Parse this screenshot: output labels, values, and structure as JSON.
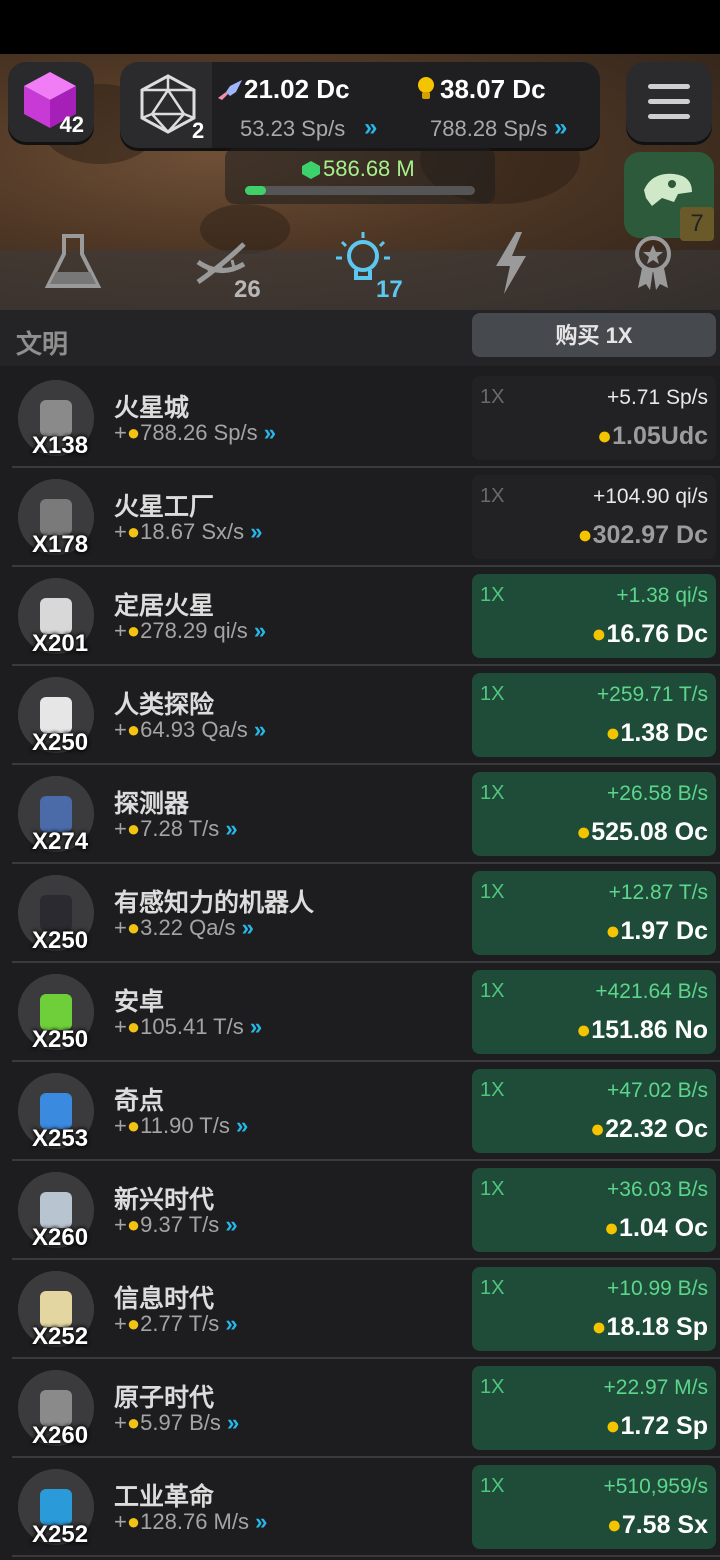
{
  "top": {
    "cube_level": "42",
    "d20_count": "2",
    "resource1": {
      "value": "21.02 Dc",
      "rate": "53.23 Sp/s"
    },
    "resource2": {
      "value": "38.07 Dc",
      "rate": "788.28 Sp/s"
    },
    "gems": {
      "value": "586.68 M",
      "progress": 0.09
    },
    "dino_badge": "7"
  },
  "tabs": [
    {
      "icon": "flask-icon",
      "badge": ""
    },
    {
      "icon": "dna-icon",
      "badge": "26"
    },
    {
      "icon": "lightbulb-icon",
      "badge": "17",
      "active": true
    },
    {
      "icon": "lightning-icon",
      "badge": ""
    },
    {
      "icon": "award-icon",
      "badge": ""
    }
  ],
  "section": {
    "title": "文明",
    "buy_label": "购买 1X"
  },
  "rows": [
    {
      "name": "火星城",
      "count": "X138",
      "rate": "788.26 Sp/s",
      "mult": "1X",
      "gain": "+5.71 Sp/s",
      "cost": "1.05Udc",
      "affordable": false,
      "color": "#8a8a8a"
    },
    {
      "name": "火星工厂",
      "count": "X178",
      "rate": "18.67 Sx/s",
      "mult": "1X",
      "gain": "+104.90 qi/s",
      "cost": "302.97 Dc",
      "affordable": false,
      "color": "#7a7a7a"
    },
    {
      "name": "定居火星",
      "count": "X201",
      "rate": "278.29 qi/s",
      "mult": "1X",
      "gain": "+1.38 qi/s",
      "cost": "16.76 Dc",
      "affordable": true,
      "color": "#d8d8d8"
    },
    {
      "name": "人类探险",
      "count": "X250",
      "rate": "64.93 Qa/s",
      "mult": "1X",
      "gain": "+259.71 T/s",
      "cost": "1.38 Dc",
      "affordable": true,
      "color": "#e6e6e6"
    },
    {
      "name": "探测器",
      "count": "X274",
      "rate": "7.28 T/s",
      "mult": "1X",
      "gain": "+26.58 B/s",
      "cost": "525.08 Oc",
      "affordable": true,
      "color": "#4a6aa8"
    },
    {
      "name": "有感知力的机器人",
      "count": "X250",
      "rate": "3.22 Qa/s",
      "mult": "1X",
      "gain": "+12.87 T/s",
      "cost": "1.97 Dc",
      "affordable": true,
      "color": "#2a2a30"
    },
    {
      "name": "安卓",
      "count": "X250",
      "rate": "105.41 T/s",
      "mult": "1X",
      "gain": "+421.64 B/s",
      "cost": "151.86 No",
      "affordable": true,
      "color": "#6fcf3a"
    },
    {
      "name": "奇点",
      "count": "X253",
      "rate": "11.90 T/s",
      "mult": "1X",
      "gain": "+47.02 B/s",
      "cost": "22.32 Oc",
      "affordable": true,
      "color": "#3a8ae0"
    },
    {
      "name": "新兴时代",
      "count": "X260",
      "rate": "9.37 T/s",
      "mult": "1X",
      "gain": "+36.03 B/s",
      "cost": "1.04 Oc",
      "affordable": true,
      "color": "#b8c4d0"
    },
    {
      "name": "信息时代",
      "count": "X252",
      "rate": "2.77 T/s",
      "mult": "1X",
      "gain": "+10.99 B/s",
      "cost": "18.18 Sp",
      "affordable": true,
      "color": "#e4d6a0"
    },
    {
      "name": "原子时代",
      "count": "X260",
      "rate": "5.97 B/s",
      "mult": "1X",
      "gain": "+22.97 M/s",
      "cost": "1.72 Sp",
      "affordable": true,
      "color": "#8a8a8a"
    },
    {
      "name": "工业革命",
      "count": "X252",
      "rate": "128.76 M/s",
      "mult": "1X",
      "gain": "+510,959/s",
      "cost": "7.58 Sx",
      "affordable": true,
      "color": "#2a9ad8"
    }
  ]
}
